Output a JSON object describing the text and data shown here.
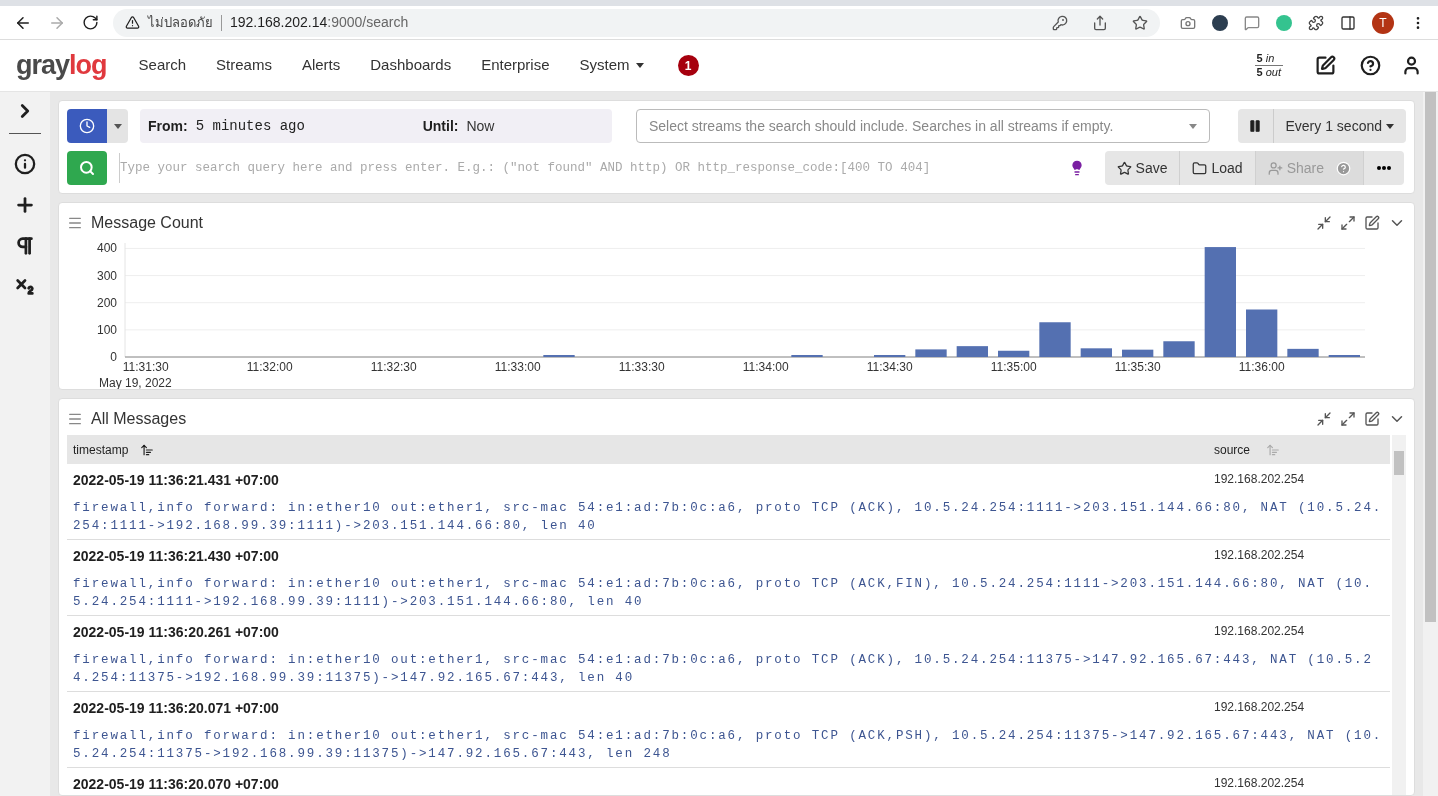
{
  "browser": {
    "security_label": "ไม่ปลอดภัย",
    "url_host": "192.168.202.14",
    "url_rest": ":9000/search",
    "profile_initial": "T"
  },
  "nav": {
    "logo": {
      "text": "gray",
      "accent": "log"
    },
    "items": [
      {
        "label": "Search",
        "has_caret": false
      },
      {
        "label": "Streams",
        "has_caret": false
      },
      {
        "label": "Alerts",
        "has_caret": false
      },
      {
        "label": "Dashboards",
        "has_caret": false
      },
      {
        "label": "Enterprise",
        "has_caret": false
      },
      {
        "label": "System",
        "has_caret": true
      }
    ],
    "notification_count": "1",
    "throughput": {
      "in_count": "5",
      "in_label": "in",
      "out_count": "5",
      "out_label": "out"
    }
  },
  "search_bar": {
    "from_label": "From:",
    "from_value": "5 minutes ago",
    "until_label": "Until:",
    "until_value": "Now",
    "streams_placeholder": "Select streams the search should include. Searches in all streams if empty.",
    "refresh_label": "Every 1 second",
    "query_placeholder": "Type your search query here and press enter. E.g.: (\"not found\" AND http) OR http_response_code:[400 TO 404]",
    "actions": [
      {
        "label": "Save",
        "disabled": false
      },
      {
        "label": "Load",
        "disabled": false
      },
      {
        "label": "Share",
        "disabled": true
      }
    ]
  },
  "message_count": {
    "title": "Message Count",
    "date_label": "May 19, 2022",
    "chart_data": {
      "type": "bar",
      "categories": [
        "11:31:30",
        null,
        null,
        "11:32:00",
        null,
        null,
        "11:32:30",
        null,
        null,
        "11:33:00",
        null,
        null,
        "11:33:30",
        null,
        null,
        "11:34:00",
        null,
        null,
        "11:34:30",
        null,
        null,
        "11:35:00",
        null,
        null,
        "11:35:30",
        null,
        null,
        "11:36:00",
        null,
        null
      ],
      "series": [
        {
          "color": "#5470b1",
          "values": [
            0,
            0,
            0,
            0,
            0,
            0,
            0,
            0,
            0,
            0,
            2,
            0,
            0,
            0,
            0,
            0,
            2,
            0,
            2,
            28,
            40,
            23,
            128,
            32,
            27,
            58,
            405,
            175,
            30,
            7
          ]
        }
      ],
      "ylim": [
        0,
        420
      ],
      "yticks": [
        0,
        100,
        200,
        300,
        400
      ],
      "grid": true
    }
  },
  "all_messages": {
    "title": "All Messages",
    "columns": [
      "timestamp",
      "source"
    ],
    "rows": [
      {
        "timestamp": "2022-05-19 11:36:21.431 +07:00",
        "source": "192.168.202.254",
        "message": "firewall,info forward: in:ether10 out:ether1, src-mac 54:e1:ad:7b:0c:a6, proto TCP (ACK), 10.5.24.254:1111->203.151.144.66:80, NAT (10.5.24.254:1111->192.168.99.39:1111)->203.151.144.66:80, len 40"
      },
      {
        "timestamp": "2022-05-19 11:36:21.430 +07:00",
        "source": "192.168.202.254",
        "message": "firewall,info forward: in:ether10 out:ether1, src-mac 54:e1:ad:7b:0c:a6, proto TCP (ACK,FIN), 10.5.24.254:1111->203.151.144.66:80, NAT (10.5.24.254:1111->192.168.99.39:1111)->203.151.144.66:80, len 40"
      },
      {
        "timestamp": "2022-05-19 11:36:20.261 +07:00",
        "source": "192.168.202.254",
        "message": "firewall,info forward: in:ether10 out:ether1, src-mac 54:e1:ad:7b:0c:a6, proto TCP (ACK), 10.5.24.254:11375->147.92.165.67:443, NAT (10.5.24.254:11375->192.168.99.39:11375)->147.92.165.67:443, len 40"
      },
      {
        "timestamp": "2022-05-19 11:36:20.071 +07:00",
        "source": "192.168.202.254",
        "message": "firewall,info forward: in:ether10 out:ether1, src-mac 54:e1:ad:7b:0c:a6, proto TCP (ACK,PSH), 10.5.24.254:11375->147.92.165.67:443, NAT (10.5.24.254:11375->192.168.99.39:11375)->147.92.165.67:443, len 248"
      },
      {
        "timestamp": "2022-05-19 11:36:20.070 +07:00",
        "source": "192.168.202.254"
      }
    ]
  }
}
